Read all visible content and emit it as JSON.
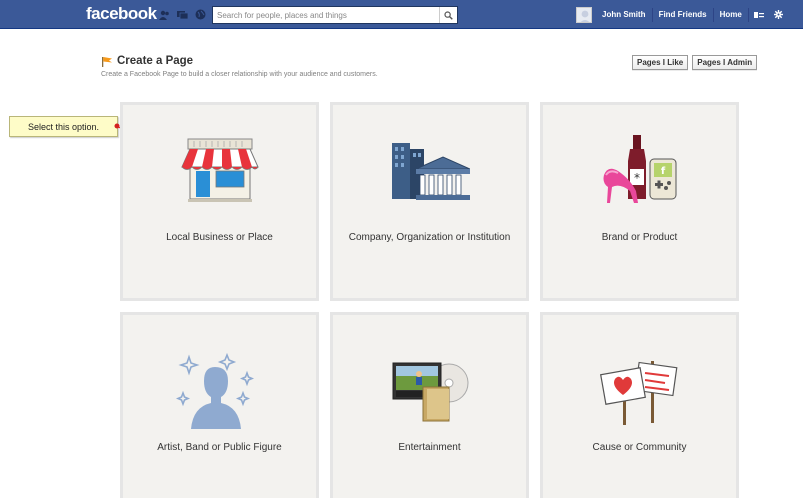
{
  "topbar": {
    "logo": "facebook",
    "search_placeholder": "Search for people, places and things",
    "user_name": "John Smith",
    "find_friends": "Find Friends",
    "home": "Home"
  },
  "header": {
    "title": "Create a Page",
    "subtitle": "Create a Facebook Page to build a closer relationship with your audience and customers.",
    "pages_i_like": "Pages I Like",
    "pages_i_admin": "Pages I Admin"
  },
  "callout": {
    "text": "Select this option."
  },
  "categories": [
    {
      "label": "Local Business or Place",
      "icon": "storefront-icon"
    },
    {
      "label": "Company, Organization or Institution",
      "icon": "office-buildings-icon"
    },
    {
      "label": "Brand or Product",
      "icon": "products-icon"
    },
    {
      "label": "Artist, Band or Public Figure",
      "icon": "person-silhouette-icon"
    },
    {
      "label": "Entertainment",
      "icon": "tv-dvd-icon"
    },
    {
      "label": "Cause or Community",
      "icon": "protest-signs-icon"
    }
  ],
  "colors": {
    "brand_blue": "#3b5998",
    "tile_bg": "#f3f2ef",
    "callout_bg": "#fefcc8",
    "arrow": "#d42020"
  }
}
